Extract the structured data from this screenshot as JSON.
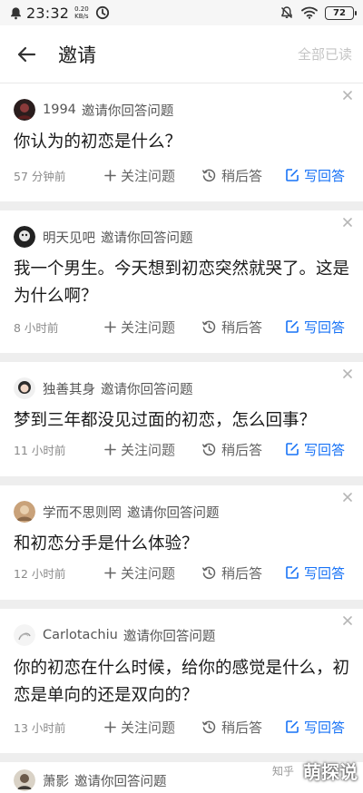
{
  "status_bar": {
    "time": "23:32",
    "net_speed_value": "0.20",
    "net_speed_unit": "KB/s",
    "battery": "72"
  },
  "header": {
    "back_icon": "arrow-left-icon",
    "title": "邀请",
    "mark_all_read": "全部已读"
  },
  "actions": {
    "follow": "关注问题",
    "later": "稍后答",
    "answer": "写回答"
  },
  "colors": {
    "accent": "#1772f6",
    "background": "#eeeeee",
    "card": "#ffffff"
  },
  "invitations": [
    {
      "inviter": "1994",
      "invite_text": "邀请你回答问题",
      "question": "你认为的初恋是什么？",
      "time": "57 分钟前"
    },
    {
      "inviter": "明天见吧",
      "invite_text": "邀请你回答问题",
      "question": "我一个男生。今天想到初恋突然就哭了。这是为什么啊？",
      "time": "8 小时前"
    },
    {
      "inviter": "独善其身",
      "invite_text": "邀请你回答问题",
      "question": "梦到三年都没见过面的初恋，怎么回事？",
      "time": "11 小时前"
    },
    {
      "inviter": "学而不思则罔",
      "invite_text": "邀请你回答问题",
      "question": "和初恋分手是什么体验？",
      "time": "12 小时前"
    },
    {
      "inviter": "Carlotachiu",
      "invite_text": "邀请你回答问题",
      "question": "你的初恋在什么时候，给你的感觉是什么，初恋是单向的还是双向的？",
      "time": "13 小时前"
    },
    {
      "inviter": "萧影",
      "invite_text": "邀请你回答问题"
    }
  ],
  "watermark": {
    "source": "知乎",
    "site": "萌探说"
  }
}
